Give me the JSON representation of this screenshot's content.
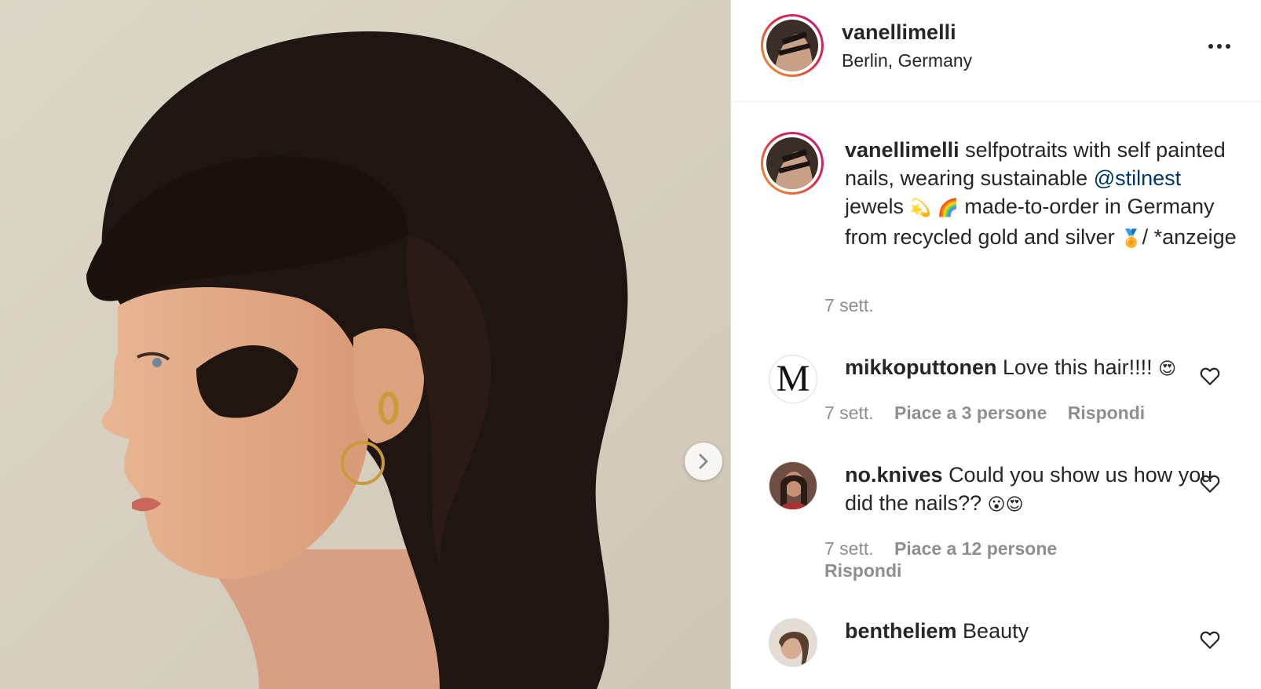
{
  "post": {
    "username": "vanellimelli",
    "location": "Berlin, Germany",
    "caption": {
      "part1": "selfpotraits with self painted nails, wearing sustainable ",
      "mention": "@stilnest",
      "part2": " jewels ",
      "emoji1": "💫",
      "emoji2": "🌈",
      "part3": " made-to-order in Germany from recycled gold and silver ",
      "emoji3": "🏅",
      "part4": "/ *anzeige"
    },
    "time": "7 sett."
  },
  "comments": [
    {
      "username": "mikkoputtonen",
      "text": "Love this hair!!!! ",
      "emoji": "😍",
      "avatar_letter": "M",
      "time": "7 sett.",
      "likes": "Piace a 3 persone",
      "reply": "Rispondi"
    },
    {
      "username": "no.knives",
      "text": "Could you show us how you did the nails?? ",
      "emoji": "😮😍",
      "time": "7 sett.",
      "likes": "Piace a 12 persone",
      "reply": "Rispondi"
    },
    {
      "username": "bentheliem",
      "text": "Beauty"
    }
  ],
  "icons": {
    "next": "chevron-right-icon",
    "more": "more-horizontal-icon",
    "like": "heart-outline-icon"
  },
  "colors": {
    "mention": "#00376b",
    "meta_text": "#8e8e8e",
    "story_ring_start": "#f09433",
    "story_ring_end": "#bc1888"
  }
}
